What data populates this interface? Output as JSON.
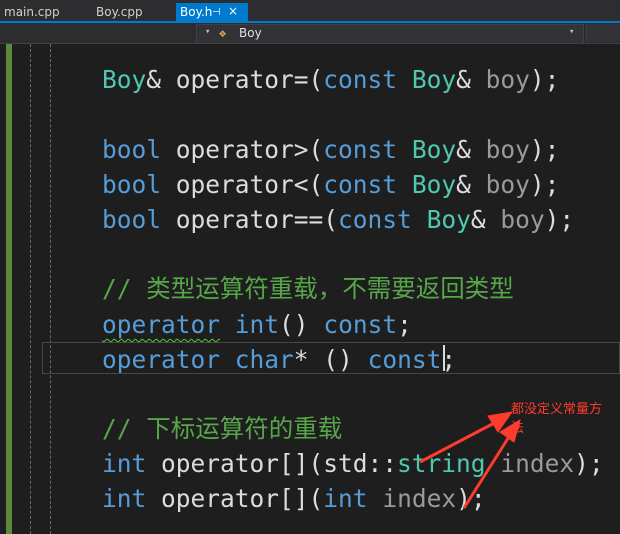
{
  "tabs": [
    {
      "label": "main.cpp",
      "active": false
    },
    {
      "label": "Boy.cpp",
      "active": false
    },
    {
      "label": "Boy.h",
      "active": true
    }
  ],
  "active_tab": {
    "pin_icon": "pin-icon",
    "close_icon": "×"
  },
  "navbar": {
    "class_name": "Boy",
    "class_icon": "class-icon"
  },
  "code_lines": [
    {
      "tokens": [
        {
          "t": "Boy",
          "c": "type"
        },
        {
          "t": "& operator=(",
          "c": "txt"
        },
        {
          "t": "const",
          "c": "kw"
        },
        {
          "t": " ",
          "c": "txt"
        },
        {
          "t": "Boy",
          "c": "type"
        },
        {
          "t": "& ",
          "c": "txt"
        },
        {
          "t": "boy",
          "c": "param"
        },
        {
          "t": ");",
          "c": "txt"
        }
      ]
    },
    {
      "tokens": [
        {
          "t": "bool",
          "c": "kw"
        },
        {
          "t": " operator>(",
          "c": "txt"
        },
        {
          "t": "const",
          "c": "kw"
        },
        {
          "t": " ",
          "c": "txt"
        },
        {
          "t": "Boy",
          "c": "type"
        },
        {
          "t": "& ",
          "c": "txt"
        },
        {
          "t": "boy",
          "c": "param"
        },
        {
          "t": ");",
          "c": "txt"
        }
      ]
    },
    {
      "tokens": [
        {
          "t": "bool",
          "c": "kw"
        },
        {
          "t": " operator<(",
          "c": "txt"
        },
        {
          "t": "const",
          "c": "kw"
        },
        {
          "t": " ",
          "c": "txt"
        },
        {
          "t": "Boy",
          "c": "type"
        },
        {
          "t": "& ",
          "c": "txt"
        },
        {
          "t": "boy",
          "c": "param"
        },
        {
          "t": ");",
          "c": "txt"
        }
      ]
    },
    {
      "tokens": [
        {
          "t": "bool",
          "c": "kw"
        },
        {
          "t": " operator==(",
          "c": "txt"
        },
        {
          "t": "const",
          "c": "kw"
        },
        {
          "t": " ",
          "c": "txt"
        },
        {
          "t": "Boy",
          "c": "type"
        },
        {
          "t": "& ",
          "c": "txt"
        },
        {
          "t": "boy",
          "c": "param"
        },
        {
          "t": ");",
          "c": "txt"
        }
      ]
    },
    {
      "tokens": [
        {
          "t": "// 类型运算符重载，不需要返回类型",
          "c": "cmt"
        }
      ]
    },
    {
      "tokens": [
        {
          "t": "operator",
          "c": "kw squiggle"
        },
        {
          "t": " ",
          "c": "txt"
        },
        {
          "t": "int",
          "c": "kw"
        },
        {
          "t": "() ",
          "c": "txt"
        },
        {
          "t": "const",
          "c": "kw"
        },
        {
          "t": ";",
          "c": "txt"
        }
      ]
    },
    {
      "tokens": [
        {
          "t": "operator",
          "c": "kw"
        },
        {
          "t": " ",
          "c": "txt"
        },
        {
          "t": "char",
          "c": "kw"
        },
        {
          "t": "* () ",
          "c": "txt"
        },
        {
          "t": "const",
          "c": "kw"
        },
        {
          "t": ";",
          "c": "txt"
        }
      ]
    },
    {
      "tokens": [
        {
          "t": "// 下标运算符的重载",
          "c": "cmt"
        }
      ]
    },
    {
      "tokens": [
        {
          "t": "int",
          "c": "kw"
        },
        {
          "t": " operator[](std::",
          "c": "txt"
        },
        {
          "t": "string",
          "c": "type"
        },
        {
          "t": " ",
          "c": "txt"
        },
        {
          "t": "index",
          "c": "param"
        },
        {
          "t": ");",
          "c": "txt"
        }
      ]
    },
    {
      "tokens": [
        {
          "t": "int",
          "c": "kw"
        },
        {
          "t": " operator[](",
          "c": "txt"
        },
        {
          "t": "int",
          "c": "kw"
        },
        {
          "t": " ",
          "c": "txt"
        },
        {
          "t": "index",
          "c": "param"
        },
        {
          "t": ");",
          "c": "txt"
        }
      ]
    }
  ],
  "annotation": {
    "text": "都没定义常量方法",
    "color": "#ff3b2f"
  }
}
